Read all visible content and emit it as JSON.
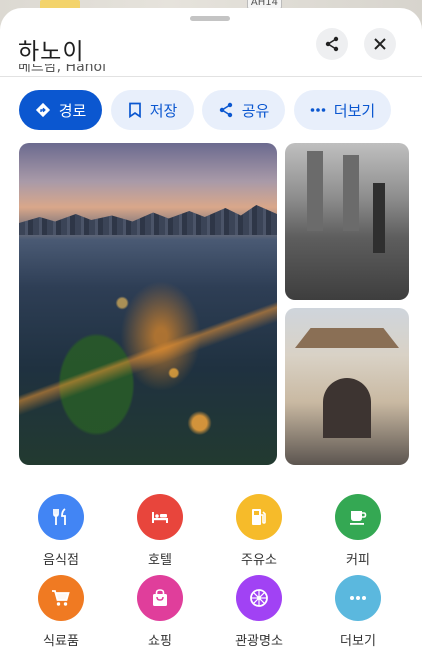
{
  "map": {
    "road_label": "AH14"
  },
  "place": {
    "title": "하노이",
    "subtitle": "베트남, Hanoi"
  },
  "actions": [
    {
      "label": "경로",
      "icon": "directions-icon",
      "primary": true
    },
    {
      "label": "저장",
      "icon": "bookmark-icon",
      "primary": false
    },
    {
      "label": "공유",
      "icon": "share-icon",
      "primary": false
    },
    {
      "label": "더보기",
      "icon": "more-horizontal-icon",
      "primary": false
    }
  ],
  "categories": [
    {
      "label": "음식점",
      "icon": "restaurant-icon",
      "color": "#4285f4"
    },
    {
      "label": "호텔",
      "icon": "hotel-icon",
      "color": "#e8453c"
    },
    {
      "label": "주유소",
      "icon": "gas-station-icon",
      "color": "#f6bb2a"
    },
    {
      "label": "커피",
      "icon": "coffee-icon",
      "color": "#34a853"
    },
    {
      "label": "식료품",
      "icon": "grocery-cart-icon",
      "color": "#f07a22"
    },
    {
      "label": "쇼핑",
      "icon": "shopping-bag-icon",
      "color": "#e03e9b"
    },
    {
      "label": "관광명소",
      "icon": "attraction-icon",
      "color": "#a142f4"
    },
    {
      "label": "더보기",
      "icon": "more-horizontal-icon",
      "color": "#5bb8de"
    }
  ],
  "colors": {
    "accent": "#0b57d0",
    "chip_bg": "#e8effb"
  }
}
